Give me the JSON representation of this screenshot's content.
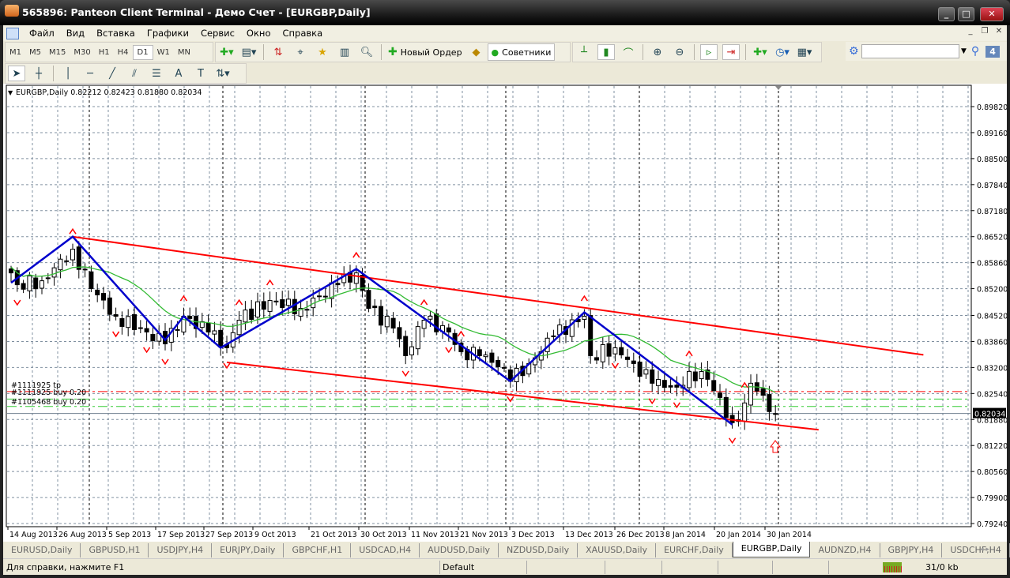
{
  "window": {
    "title": "565896: Panteon Client Terminal - Демо Счет - [EURGBP,Daily]"
  },
  "menu": [
    "Файл",
    "Вид",
    "Вставка",
    "Графики",
    "Сервис",
    "Окно",
    "Справка"
  ],
  "timeframes": [
    "M1",
    "M5",
    "M15",
    "M30",
    "H1",
    "H4",
    "D1",
    "W1",
    "MN"
  ],
  "selected_timeframe": "D1",
  "toolbar": {
    "new_order": "Новый Ордер",
    "experts": "Советники",
    "alerts_badge": "4",
    "search_placeholder": ""
  },
  "chart": {
    "header": "EURGBP,Daily  0.82212 0.82423 0.81880 0.82034",
    "current_price": "0.82034",
    "price_labels": [
      "0.89820",
      "0.89160",
      "0.88500",
      "0.87840",
      "0.87180",
      "0.86520",
      "0.85860",
      "0.85200",
      "0.84520",
      "0.83860",
      "0.83200",
      "0.82540",
      "0.81880",
      "0.81220",
      "0.80560",
      "0.79900",
      "0.79240"
    ],
    "date_labels": [
      "14 Aug 2013",
      "26 Aug 2013",
      "5 Sep 2013",
      "17 Sep 2013",
      "27 Sep 2013",
      "9 Oct 2013",
      "21 Oct 2013",
      "30 Oct 2013",
      "11 Nov 2013",
      "21 Nov 2013",
      "3 Dec 2013",
      "13 Dec 2013",
      "26 Dec 2013",
      "8 Jan 2014",
      "20 Jan 2014",
      "30 Jan 2014"
    ],
    "order_labels": [
      "#1111925 tp",
      "#1111925 buy 0.20",
      "#1105468 buy 0.20"
    ],
    "order_levels": [
      0.8259,
      0.824,
      0.8221
    ],
    "colors": {
      "bull": "#ffffff",
      "bear": "#000000",
      "zigzag": "#0000cc",
      "channel": "#ff0000",
      "ma": "#33bb33",
      "tp": "#ff0000",
      "buy": "#33cc33"
    }
  },
  "chart_data": {
    "type": "candlestick",
    "symbol": "EURGBP",
    "timeframe": "Daily",
    "ylim": [
      0.7924,
      0.8982
    ],
    "close_path": [
      [
        0,
        0.856
      ],
      [
        1,
        0.853
      ],
      [
        5,
        0.854
      ],
      [
        10,
        0.862
      ],
      [
        13,
        0.852
      ],
      [
        17,
        0.845
      ],
      [
        22,
        0.841
      ],
      [
        25,
        0.838
      ],
      [
        28,
        0.845
      ],
      [
        32,
        0.841
      ],
      [
        35,
        0.837
      ],
      [
        37,
        0.844
      ],
      [
        42,
        0.849
      ],
      [
        47,
        0.847
      ],
      [
        53,
        0.853
      ],
      [
        56,
        0.856
      ],
      [
        58,
        0.847
      ],
      [
        62,
        0.842
      ],
      [
        64,
        0.835
      ],
      [
        67,
        0.844
      ],
      [
        71,
        0.841
      ],
      [
        73,
        0.836
      ],
      [
        76,
        0.835
      ],
      [
        80,
        0.832
      ],
      [
        81,
        0.8285
      ],
      [
        84,
        0.833
      ],
      [
        88,
        0.84
      ],
      [
        93,
        0.845
      ],
      [
        94,
        0.835
      ],
      [
        98,
        0.837
      ],
      [
        101,
        0.833
      ],
      [
        104,
        0.828
      ],
      [
        108,
        0.827
      ],
      [
        110,
        0.831
      ],
      [
        113,
        0.829
      ],
      [
        117,
        0.818
      ],
      [
        119,
        0.823
      ],
      [
        120,
        0.828
      ],
      [
        124,
        0.8203
      ]
    ],
    "zigzag": [
      [
        0,
        0.8535
      ],
      [
        10,
        0.8652
      ],
      [
        25,
        0.839
      ],
      [
        28,
        0.845
      ],
      [
        34,
        0.837
      ],
      [
        56,
        0.857
      ],
      [
        81,
        0.8285
      ],
      [
        93,
        0.846
      ],
      [
        117,
        0.8175
      ]
    ],
    "channel_top": [
      [
        10,
        0.8652
      ],
      [
        148,
        0.8352
      ]
    ],
    "channel_bottom": [
      [
        35,
        0.8333
      ],
      [
        131,
        0.8162
      ]
    ],
    "fractals_up": [
      10,
      28,
      37,
      42,
      56,
      67,
      73,
      93,
      110,
      119
    ],
    "fractals_down": [
      1,
      17,
      22,
      25,
      35,
      64,
      71,
      81,
      98,
      104,
      108,
      117
    ]
  },
  "tabs": [
    "EURUSD,Daily",
    "GBPUSD,H1",
    "USDJPY,H4",
    "EURJPY,Daily",
    "GBPCHF,H1",
    "USDCAD,H4",
    "AUDUSD,Daily",
    "NZDUSD,Daily",
    "XAUUSD,Daily",
    "EURCHF,Daily",
    "EURGBP,Daily",
    "AUDNZD,H4",
    "GBPJPY,H4",
    "USDCHF,H4"
  ],
  "active_tab": "EURGBP,Daily",
  "status": {
    "help": "Для справки, нажмите F1",
    "profile": "Default",
    "traffic": "31/0 kb"
  }
}
